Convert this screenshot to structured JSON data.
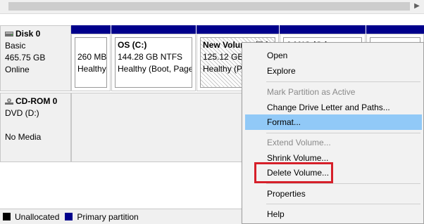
{
  "disks": {
    "disk0": {
      "name": "Disk 0",
      "type": "Basic",
      "size": "465.75 GB",
      "status": "Online"
    },
    "cdrom0": {
      "name": "CD-ROM 0",
      "drive": "DVD (D:)",
      "status": "No Media"
    }
  },
  "partitions": [
    {
      "title": "",
      "size": "260 MB",
      "status": "Healthy"
    },
    {
      "title": "OS  (C:)",
      "size": "144.28 GB NTFS",
      "status": "Healthy (Boot, Page"
    },
    {
      "title": "New Volume  (E:)",
      "size": "125.12 GB N",
      "status": "Healthy (Pr"
    },
    {
      "title": "AANC  (G:)",
      "size": "",
      "status": ""
    },
    {
      "title": "",
      "size": "",
      "status": ""
    }
  ],
  "context_menu": {
    "open": "Open",
    "explore": "Explore",
    "mark_active": "Mark Partition as Active",
    "change_letter": "Change Drive Letter and Paths...",
    "format": "Format...",
    "extend": "Extend Volume...",
    "shrink": "Shrink Volume...",
    "delete": "Delete Volume...",
    "properties": "Properties",
    "help": "Help"
  },
  "legend": {
    "unallocated": "Unallocated",
    "primary": "Primary partition"
  },
  "colors": {
    "partition_cap": "#00008b",
    "menu_highlight": "#91c9f7",
    "annotation_red": "#d6202a"
  }
}
